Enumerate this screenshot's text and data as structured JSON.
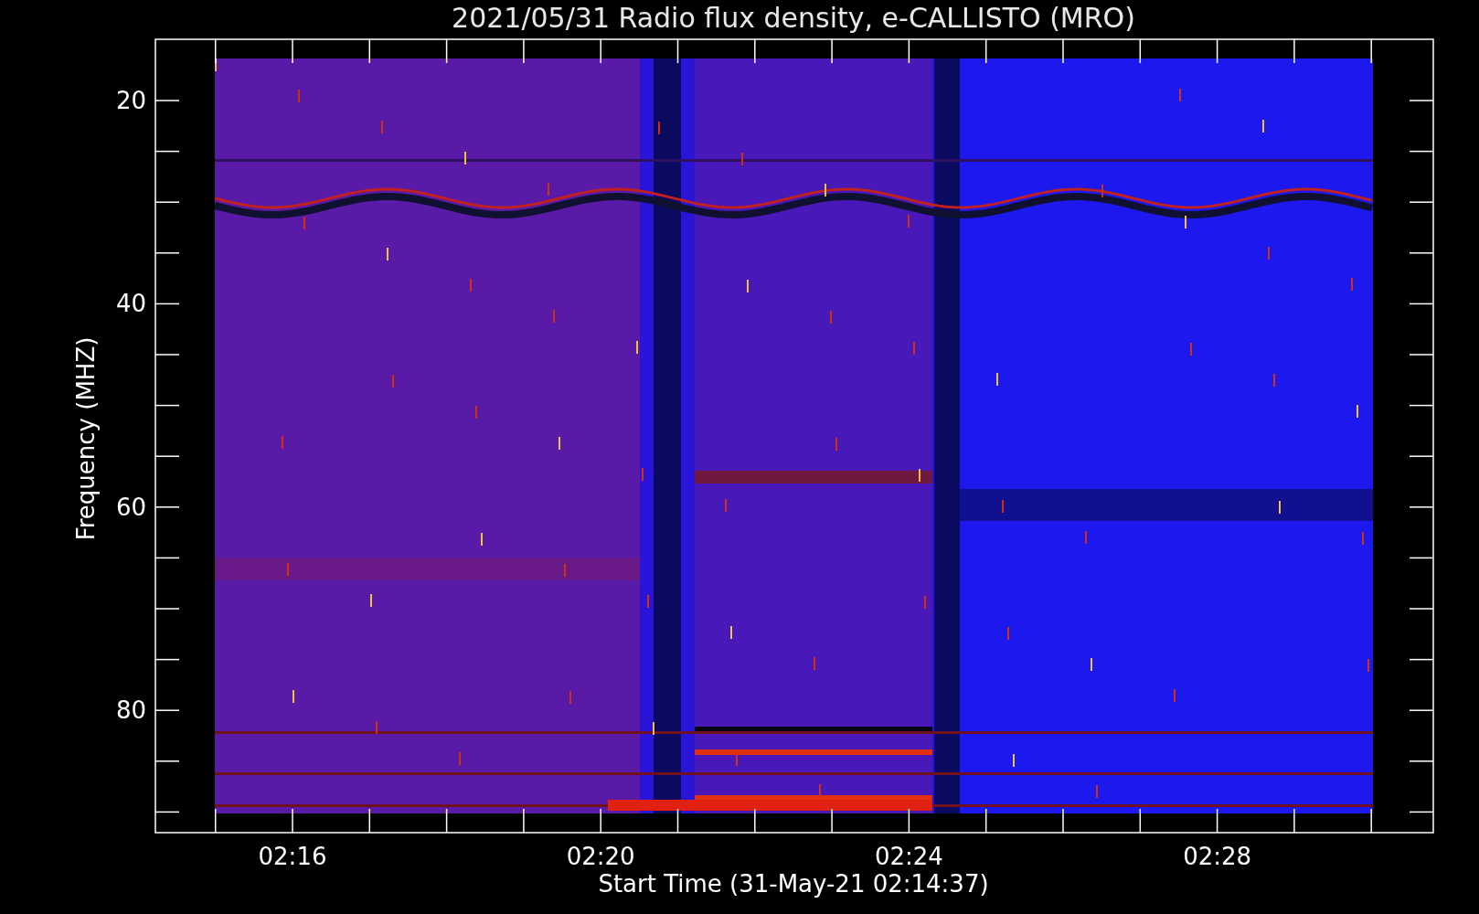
{
  "title": "2021/05/31  Radio flux density, e-CALLISTO (MRO)",
  "y_axis": {
    "label": "Frequency (MHZ)",
    "tick_labels": [
      "20",
      "40",
      "60",
      "80"
    ]
  },
  "x_axis": {
    "label": "Start Time (31-May-21 02:14:37)",
    "tick_labels": [
      "02:16",
      "02:20",
      "02:24",
      "02:28"
    ]
  }
}
